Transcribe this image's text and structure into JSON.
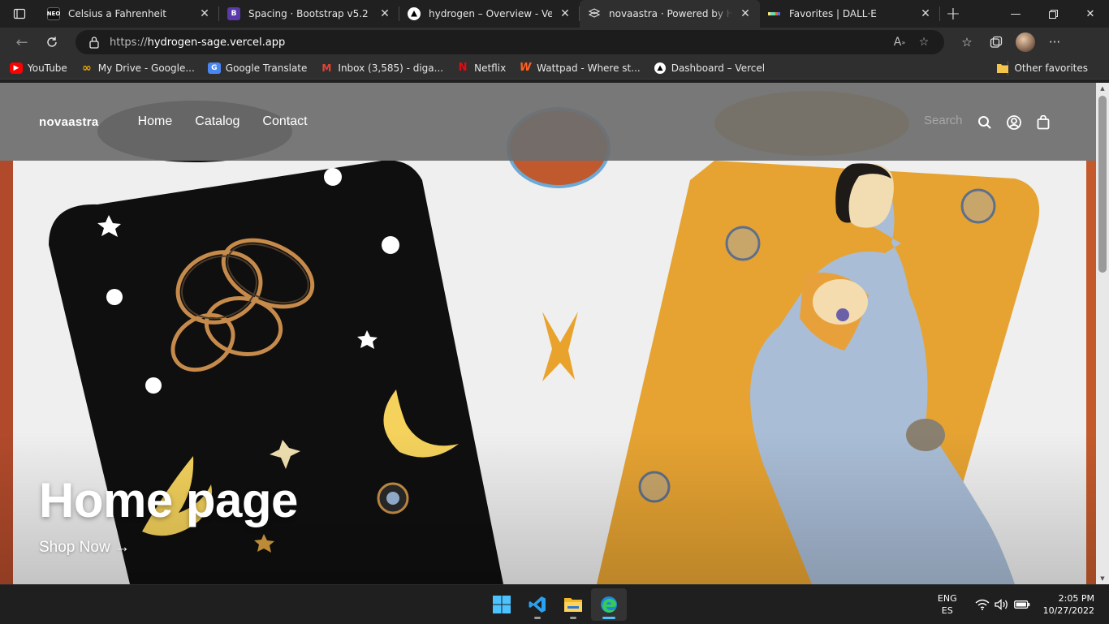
{
  "browser": {
    "tabs": [
      {
        "title": "Celsius a Fahrenheit",
        "icon": "neo-icon",
        "active": false
      },
      {
        "title": "Spacing · Bootstrap v5.2",
        "icon": "bootstrap-icon",
        "active": false
      },
      {
        "title": "hydrogen – Overview - Vercel",
        "icon": "vercel-icon",
        "active": false
      },
      {
        "title": "novaastra · Powered by Hydrogen",
        "icon": "hydrogen-icon",
        "active": true
      },
      {
        "title": "Favorites | DALL·E",
        "icon": "dalle-icon",
        "active": false
      }
    ],
    "url_prefix": "https://",
    "url_host": "hydrogen-sage.vercel.app",
    "favorites": [
      {
        "label": "YouTube",
        "icon": "youtube-icon"
      },
      {
        "label": "My Drive - Google...",
        "icon": "drive-icon"
      },
      {
        "label": "Google Translate",
        "icon": "translate-icon"
      },
      {
        "label": "Inbox (3,585) - diga...",
        "icon": "gmail-icon"
      },
      {
        "label": "Netflix",
        "icon": "netflix-icon"
      },
      {
        "label": "Wattpad - Where st...",
        "icon": "wattpad-icon"
      },
      {
        "label": "Dashboard – Vercel",
        "icon": "vercel-icon"
      }
    ],
    "other_favorites": "Other favorites"
  },
  "site": {
    "logo": "novaastra",
    "nav": [
      "Home",
      "Catalog",
      "Contact"
    ],
    "search_placeholder": "Search",
    "hero_title": "Home page",
    "hero_cta": "Shop Now →"
  },
  "taskbar": {
    "apps": [
      "windows-start-icon",
      "vscode-icon",
      "file-explorer-icon",
      "edge-icon"
    ],
    "active_app": "edge-icon",
    "lang_primary": "ENG",
    "lang_secondary": "ES",
    "time": "2:05 PM",
    "date": "10/27/2022"
  },
  "colors": {
    "header_overlay": "#6e6e6e",
    "card_black": "#0e0e0e",
    "card_gold": "#e7a22f",
    "robe_blue": "#a9bdd6",
    "moon_yellow": "#f6d25a",
    "edge_accent": "#4cc2ff"
  }
}
